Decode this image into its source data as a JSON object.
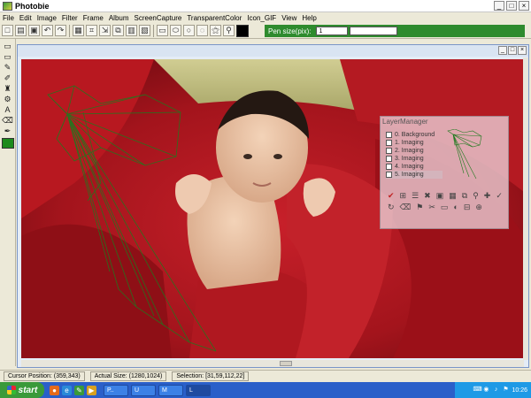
{
  "window": {
    "title": "Photobie"
  },
  "window_buttons": [
    "_",
    "□",
    "×"
  ],
  "menu": [
    "File",
    "Edit",
    "Image",
    "Filter",
    "Frame",
    "Album",
    "ScreenCapture",
    "TransparentColor",
    "Icon_GIF",
    "View",
    "Help"
  ],
  "toolbar": {
    "buttons": [
      "new-icon",
      "open-icon",
      "save-icon",
      "undo-icon",
      "redo-icon",
      "layer-icon",
      "crop-icon",
      "resize-icon",
      "copy-icon",
      "paste-icon",
      "print-icon",
      "rect-select-icon",
      "ellipse-select-icon",
      "circle-icon",
      "lasso-icon",
      "wand-icon",
      "zoom-icon"
    ],
    "foreground_color": "#000000"
  },
  "pen_size": {
    "label": "Pen size(pix):",
    "value": "1",
    "panel_color": "#2e8b2e"
  },
  "tools": [
    "rect-tool-icon",
    "ellipse-tool-icon",
    "pencil-icon",
    "brush-icon",
    "bucket-icon",
    "clone-icon",
    "text-icon",
    "eraser-icon",
    "picker-icon"
  ],
  "tool_color": "#1c8a1c",
  "layer_manager": {
    "title": "LayerManager",
    "layers": [
      "0. Background",
      "1. Imaging",
      "2. Imaging",
      "3. Imaging",
      "4. Imaging",
      "5. Imaging"
    ],
    "selected_index": 5,
    "tools": [
      "✔",
      "⊞",
      "☰",
      "✖",
      "▣",
      "▦",
      "⧉",
      "⚲",
      "✚",
      "✓",
      "↻",
      "⌫",
      "⚑",
      "✂",
      "▭",
      "◐",
      "⊟",
      "⊕"
    ]
  },
  "status": {
    "cursor": "Cursor Position: (359,343)",
    "actual_size": "Actual Size: (1280,1024)",
    "selection": "Selection: [31,59,112,22]"
  },
  "taskbar": {
    "start": "start",
    "tasks": [
      "P..",
      "U",
      "M",
      "L"
    ],
    "time": "10:26"
  }
}
